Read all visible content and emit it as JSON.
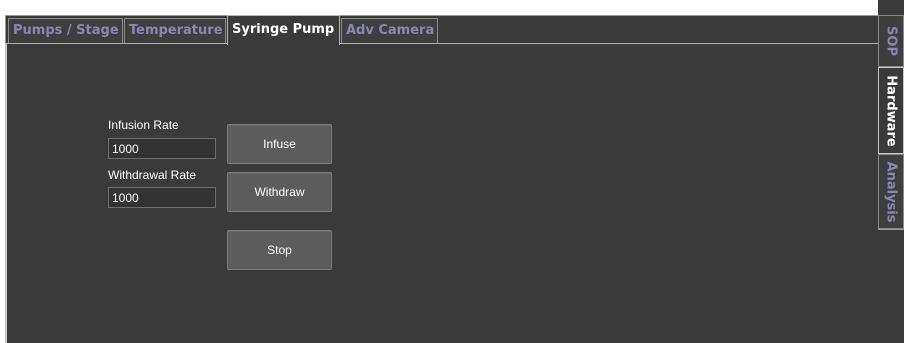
{
  "tabs": [
    {
      "label": "Pumps / Stage"
    },
    {
      "label": "Temperature"
    },
    {
      "label": "Syringe Pump"
    },
    {
      "label": "Adv Camera"
    }
  ],
  "active_tab": "Syringe Pump",
  "side_tabs": [
    {
      "label": "SOP"
    },
    {
      "label": "Hardware"
    },
    {
      "label": "Analysis"
    }
  ],
  "active_side_tab": "Hardware",
  "syringe": {
    "infusion_rate_label": "Infusion Rate",
    "infusion_rate_value": "1000",
    "withdrawal_rate_label": "Withdrawal Rate",
    "withdrawal_rate_value": "1000",
    "infuse_label": "Infuse",
    "withdraw_label": "Withdraw",
    "stop_label": "Stop"
  },
  "colors": {
    "panel_bg": "#3a3a3a",
    "inactive_tab_text": "#8a87b5",
    "active_tab_text": "#ffffff",
    "button_bg": "#5c5c5c"
  }
}
